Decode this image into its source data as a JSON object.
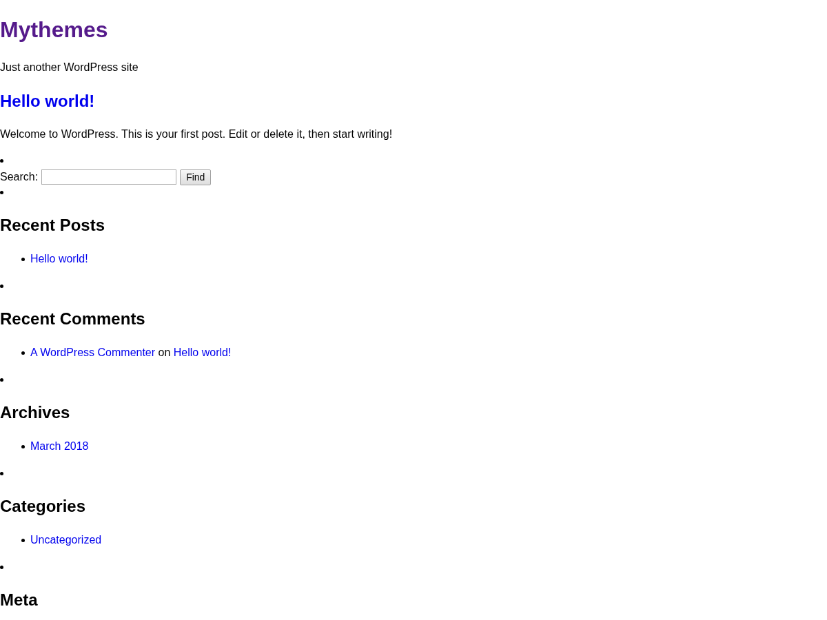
{
  "site": {
    "title": "Mythemes",
    "title_visited": true,
    "tagline": "Just another WordPress site"
  },
  "post": {
    "title": "Hello world!",
    "title_visited": false,
    "excerpt": "Welcome to WordPress. This is your first post. Edit or delete it, then start writing!"
  },
  "widgets": [
    {
      "kind": "search",
      "label": "Search:",
      "button": "Find"
    },
    {
      "kind": "list",
      "title": "Recent Posts",
      "items": [
        {
          "parts": [
            {
              "text": "Hello world!",
              "kind": "link"
            }
          ]
        }
      ]
    },
    {
      "kind": "list",
      "title": "Recent Comments",
      "items": [
        {
          "parts": [
            {
              "text": "A WordPress Commenter",
              "kind": "link"
            },
            {
              "text": " on ",
              "kind": "text"
            },
            {
              "text": "Hello world!",
              "kind": "link"
            }
          ]
        }
      ]
    },
    {
      "kind": "list",
      "title": "Archives",
      "items": [
        {
          "parts": [
            {
              "text": "March 2018",
              "kind": "link"
            }
          ]
        }
      ]
    },
    {
      "kind": "list",
      "title": "Categories",
      "items": [
        {
          "parts": [
            {
              "text": "Uncategorized",
              "kind": "link"
            }
          ]
        }
      ]
    },
    {
      "kind": "list",
      "title": "Meta"
    }
  ]
}
